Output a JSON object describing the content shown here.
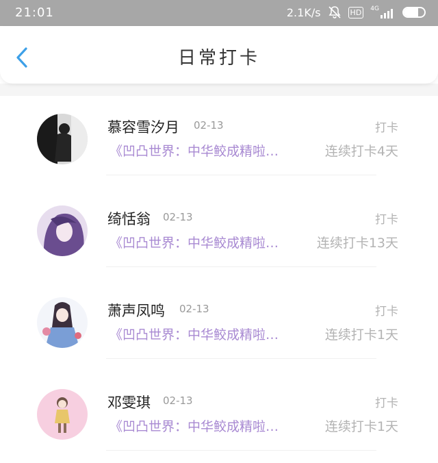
{
  "status_bar": {
    "time": "21:01",
    "speed": "2.1K/s",
    "hd": "HD",
    "network": "4G",
    "battery_level": 0.7
  },
  "header": {
    "title": "日常打卡",
    "back_icon": "chevron-left-icon"
  },
  "colors": {
    "accent_blue": "#3da0e8",
    "book_purple": "#a889d2",
    "muted_gray": "#b3b3b3"
  },
  "entries": [
    {
      "name": "慕容雪汐月",
      "date": "02-13",
      "action": "打卡",
      "book": "《凹凸世界：中华鲛成精啦…",
      "streak": "连续打卡4天"
    },
    {
      "name": "绮恬翁",
      "date": "02-13",
      "action": "打卡",
      "book": "《凹凸世界：中华鲛成精啦…",
      "streak": "连续打卡13天"
    },
    {
      "name": "萧声凤鸣",
      "date": "02-13",
      "action": "打卡",
      "book": "《凹凸世界：中华鲛成精啦…",
      "streak": "连续打卡1天"
    },
    {
      "name": "邓雯琪",
      "date": "02-13",
      "action": "打卡",
      "book": "《凹凸世界：中华鲛成精啦…",
      "streak": "连续打卡1天"
    }
  ]
}
